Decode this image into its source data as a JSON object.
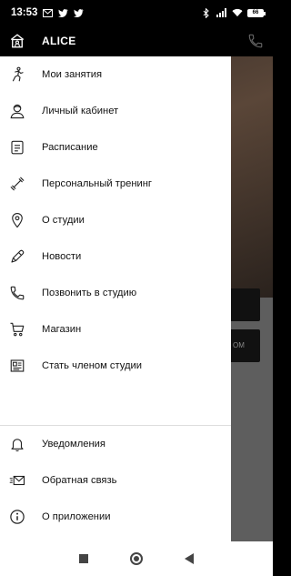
{
  "status_bar": {
    "time": "13:53",
    "left_icons": [
      "gmail-icon",
      "twitter-icon",
      "twitter-icon"
    ],
    "right_icons": [
      "bluetooth-icon",
      "signal-icon",
      "wifi-icon",
      "battery-icon"
    ],
    "battery": "66"
  },
  "drawer": {
    "title": "ALICE",
    "items": [
      {
        "label": "Мои занятия",
        "icon": "runner-icon"
      },
      {
        "label": "Личный кабинет",
        "icon": "user-icon"
      },
      {
        "label": "Расписание",
        "icon": "schedule-icon"
      },
      {
        "label": "Персональный тренинг",
        "icon": "dumbbell-icon"
      },
      {
        "label": "О студии",
        "icon": "location-icon"
      },
      {
        "label": "Новости",
        "icon": "pen-icon"
      },
      {
        "label": "Позвонить в студию",
        "icon": "phone-icon"
      },
      {
        "label": "Магазин",
        "icon": "cart-icon"
      },
      {
        "label": "Стать членом студии",
        "icon": "membership-icon"
      }
    ],
    "bottom_items": [
      {
        "label": "Уведомления",
        "icon": "bell-icon"
      },
      {
        "label": "Обратная связь",
        "icon": "feedback-icon"
      },
      {
        "label": "О приложении",
        "icon": "info-icon"
      }
    ]
  },
  "background": {
    "button_fragment": "ОМ"
  },
  "colors": {
    "header": "#000000",
    "drawer_bg": "#ffffff",
    "text": "#111111"
  }
}
